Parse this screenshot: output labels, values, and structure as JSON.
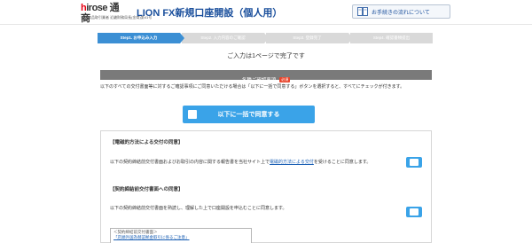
{
  "header": {
    "logo_main_red": "h",
    "logo_main_rest": "irose 通商",
    "logo_sub": "金融商品取引業者 近畿財務局長(金商)第41号",
    "title": "LION FX新規口座開設（個人用）",
    "flow_link_label": "お手続きの流れについて",
    "flow_icon": "book-icon"
  },
  "steps": [
    {
      "label": "Step1. お申込み入力",
      "active": true
    },
    {
      "label": "Step2. 入力内容のご確認",
      "active": false
    },
    {
      "label": "Step3. 登録完了",
      "active": false
    },
    {
      "label": "Step4. 確認書類提出",
      "active": false
    }
  ],
  "complete_message": "ご入力は1ページで完了です",
  "section": {
    "title": "各種ご確認事項",
    "badge": "必須"
  },
  "instructions": "以下のすべての交付書面等に対するご確認事項にご同意いただける場合は「以下に一括で同意する」ボタンを選択すると、すべてにチェックが付きます。",
  "agree_all_label": "以下に一括で同意する",
  "items": [
    {
      "title": "【電磁的方法による交付の同意】",
      "desc_before": "以下の契約締結前交付書面およびお取引の内容に関する報告書を当社サイト上で",
      "desc_link": "電磁的方法による交付",
      "desc_after": "を受けることに同意します。"
    },
    {
      "title": "【契約締結前交付書面への同意】",
      "desc_before": "以下の契約締結前交付書面を熟読し、理解した上で口座開設を申込むことに同意します。",
      "desc_link": "",
      "desc_after": ""
    }
  ],
  "doc_box": {
    "heading": "＜契約締結前交付書面＞",
    "link": "「店頭外国為替証拠金取引に係るご注意」"
  },
  "colors": {
    "accent": "#3aa3e8",
    "step_active": "#3b8fd4",
    "step_inactive": "#d9d9d9",
    "brand_red": "#e60012",
    "title_blue": "#1a4f9c"
  }
}
